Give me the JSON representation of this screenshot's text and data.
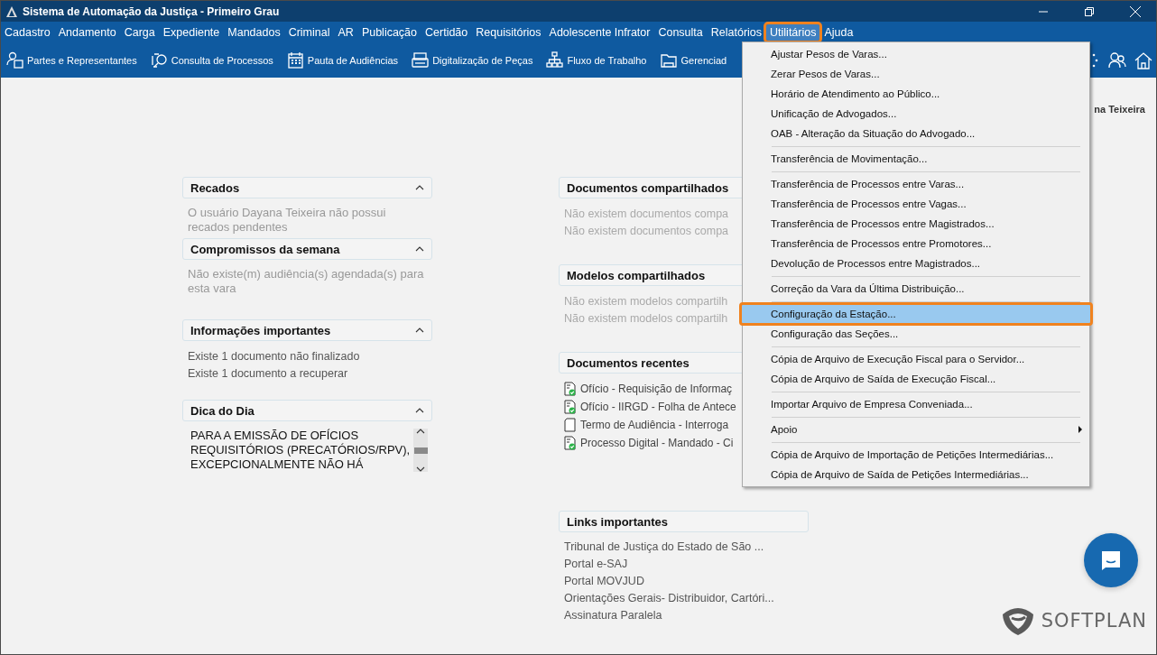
{
  "window": {
    "title": "Sistema de Automação da Justiça - Primeiro Grau"
  },
  "menu_bar": [
    {
      "label": "Cadastro",
      "selected": false
    },
    {
      "label": "Andamento",
      "selected": false
    },
    {
      "label": "Carga",
      "selected": false
    },
    {
      "label": "Expediente",
      "selected": false
    },
    {
      "label": "Mandados",
      "selected": false
    },
    {
      "label": "Criminal",
      "selected": false
    },
    {
      "label": "AR",
      "selected": false
    },
    {
      "label": "Publicação",
      "selected": false
    },
    {
      "label": "Certidão",
      "selected": false
    },
    {
      "label": "Requisitórios",
      "selected": false
    },
    {
      "label": "Adolescente Infrator",
      "selected": false
    },
    {
      "label": "Consulta",
      "selected": false
    },
    {
      "label": "Relatórios",
      "selected": false
    },
    {
      "label": "Utilitários",
      "selected": true
    },
    {
      "label": "Ajuda",
      "selected": false
    }
  ],
  "toolbar": [
    {
      "label": "Partes e Representantes"
    },
    {
      "label": "Consulta de Processos"
    },
    {
      "label": "Pauta de Audiências"
    },
    {
      "label": "Digitalização de Peças"
    },
    {
      "label": "Fluxo de Trabalho"
    },
    {
      "label": "Gerenciad"
    }
  ],
  "user_name": "na Teixeira",
  "dropdown": [
    {
      "kind": "item",
      "label": "Ajustar Pesos de Varas...",
      "selected": false
    },
    {
      "kind": "item",
      "label": "Zerar Pesos de Varas...",
      "selected": false
    },
    {
      "kind": "item",
      "label": "Horário de Atendimento ao Público...",
      "selected": false
    },
    {
      "kind": "item",
      "label": "Unificação de Advogados...",
      "selected": false
    },
    {
      "kind": "item",
      "label": "OAB - Alteração da Situação do Advogado...",
      "selected": false
    },
    {
      "kind": "separator"
    },
    {
      "kind": "item",
      "label": "Transferência de Movimentação...",
      "selected": false
    },
    {
      "kind": "separator"
    },
    {
      "kind": "item",
      "label": "Transferência de Processos entre Varas...",
      "selected": false
    },
    {
      "kind": "item",
      "label": "Transferência de Processos entre Vagas...",
      "selected": false
    },
    {
      "kind": "item",
      "label": "Transferência de Processos entre Magistrados...",
      "selected": false
    },
    {
      "kind": "item",
      "label": "Transferência de Processos entre Promotores...",
      "selected": false
    },
    {
      "kind": "item",
      "label": "Devolução de Processos entre Magistrados...",
      "selected": false
    },
    {
      "kind": "separator"
    },
    {
      "kind": "item",
      "label": "Correção da Vara da Última Distribuição...",
      "selected": false
    },
    {
      "kind": "separator"
    },
    {
      "kind": "item",
      "label": "Configuração da Estação...",
      "selected": true
    },
    {
      "kind": "item",
      "label": "Configuração das Seções...",
      "selected": false
    },
    {
      "kind": "separator"
    },
    {
      "kind": "item",
      "label": "Cópia de Arquivo de Execução Fiscal para o Servidor...",
      "selected": false
    },
    {
      "kind": "item",
      "label": "Cópia de Arquivo de Saída de Execução Fiscal...",
      "selected": false
    },
    {
      "kind": "separator"
    },
    {
      "kind": "item",
      "label": "Importar Arquivo de Empresa Conveniada...",
      "selected": false
    },
    {
      "kind": "separator"
    },
    {
      "kind": "submenu",
      "label": "Apoio",
      "selected": false
    },
    {
      "kind": "separator"
    },
    {
      "kind": "item",
      "label": "Cópia de Arquivo de Importação de Petições Intermediárias...",
      "selected": false
    },
    {
      "kind": "item",
      "label": "Cópia de Arquivo de Saída de Petições Intermediárias...",
      "selected": false
    }
  ],
  "left_panels": [
    {
      "title": "Recados",
      "expanded": true,
      "kind": "note",
      "lines": [
        "O usuário Dayana Teixeira não possui recados pendentes"
      ]
    },
    {
      "title": "Compromissos da semana",
      "expanded": true,
      "kind": "note",
      "lines": [
        "Não existe(m) audiência(s) agendada(s) para esta vara"
      ]
    },
    {
      "title": "Informações importantes",
      "expanded": true,
      "kind": "info",
      "lines": [
        "Existe 1 documento não finalizado",
        "Existe 1 documento a recuperar"
      ]
    },
    {
      "title": "Dica do Dia",
      "expanded": true,
      "kind": "tip",
      "lines": [
        "PARA A EMISSÃO DE OFÍCIOS",
        "REQUISITÓRIOS (PRECATÓRIOS/RPV),",
        "EXCEPCIONALMENTE NÃO HÁ"
      ]
    }
  ],
  "right_panels": [
    {
      "title": "Documentos compartilhados",
      "kind": "note",
      "lines": [
        "Não existem documentos compa",
        "Não existem documentos compa"
      ]
    },
    {
      "title": "Modelos compartilhados",
      "kind": "note",
      "lines": [
        "Não existem modelos compartilh",
        "Não existem modelos compartilh"
      ]
    },
    {
      "title": "Documentos recentes",
      "kind": "documents",
      "items": [
        {
          "kind": "signed",
          "label": "Ofício - Requisição de Informaç"
        },
        {
          "kind": "signed",
          "label": "Ofício - IIRGD - Folha de Antece"
        },
        {
          "kind": "blank",
          "label": "Termo de Audiência - Interroga"
        },
        {
          "kind": "signed",
          "label": "Processo Digital - Mandado - Ci"
        }
      ]
    },
    {
      "title": "Links importantes",
      "kind": "links",
      "lines": [
        "Tribunal de Justiça do Estado de São ...",
        "Portal e-SAJ",
        "Portal MOVJUD",
        "Orientações Gerais- Distribuidor, Cartóri...",
        "Assinatura Paralela"
      ]
    }
  ],
  "brand": "SOFTPLAN"
}
